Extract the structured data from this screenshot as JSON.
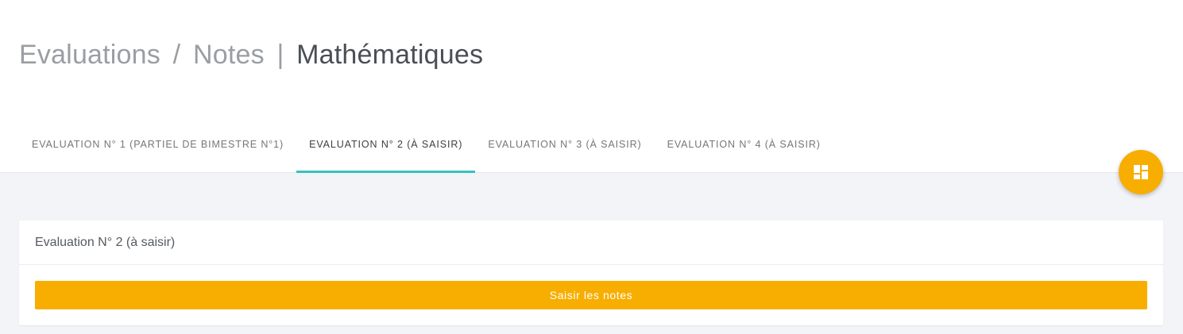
{
  "header": {
    "breadcrumb": [
      "Evaluations",
      "Notes"
    ],
    "breadcrumb_sep": "/",
    "title_sep": "|",
    "current": "Mathématiques"
  },
  "tabs": [
    {
      "label": "EVALUATION N° 1 (PARTIEL DE BIMESTRE N°1)",
      "active": false
    },
    {
      "label": "EVALUATION N° 2 (À SAISIR)",
      "active": true
    },
    {
      "label": "EVALUATION N° 3 (À SAISIR)",
      "active": false
    },
    {
      "label": "EVALUATION N° 4 (À SAISIR)",
      "active": false
    }
  ],
  "card": {
    "title": "Evaluation N° 2 (à saisir)",
    "button_label": "Saisir les notes"
  },
  "fab": {
    "icon": "dashboard-icon"
  },
  "colors": {
    "accent": "#f7ae00",
    "tab_indicator": "#36c1c1",
    "background": "#f3f4f7"
  }
}
